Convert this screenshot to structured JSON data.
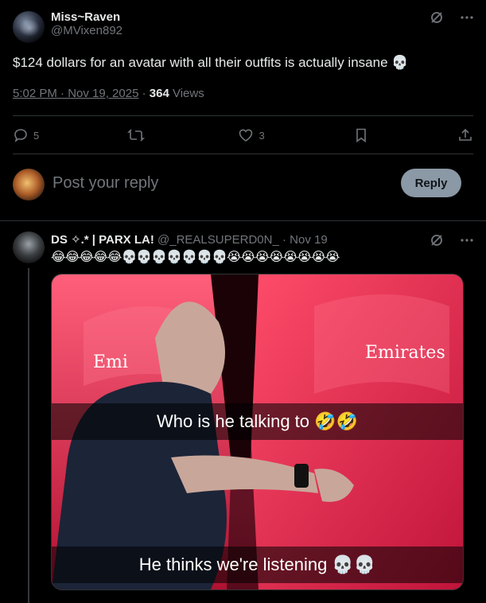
{
  "post": {
    "name": "Miss~Raven",
    "handle": "@MVixen892",
    "text": "$124 dollars for an avatar with all their outfits is actually insane 💀",
    "time": "5:02 PM · Nov 19, 2025",
    "views_count": "364",
    "views_label": "Views",
    "stats": {
      "replies": "5",
      "reposts": "",
      "likes": "3"
    }
  },
  "reply_box": {
    "placeholder": "Post your reply",
    "button": "Reply"
  },
  "comment": {
    "name": "DS ✧.* | PARX LA!",
    "handle": "@_REALSUPERD0N_",
    "date": "· Nov 19",
    "emojis": "😂😂😂😂😂💀💀💀💀💀💀💀😭😭😭😭😭😭😭😭",
    "image": {
      "logo_left": "Emi",
      "logo_right": "Emirates",
      "caption_top": "Who is he talking to 🤣🤣",
      "caption_bottom": "He thinks we're listening 💀💀"
    }
  },
  "icons": {
    "grok": "grok-icon",
    "more": "more-icon",
    "reply": "reply-icon",
    "repost": "repost-icon",
    "like": "heart-icon",
    "bookmark": "bookmark-icon",
    "share": "share-icon"
  }
}
